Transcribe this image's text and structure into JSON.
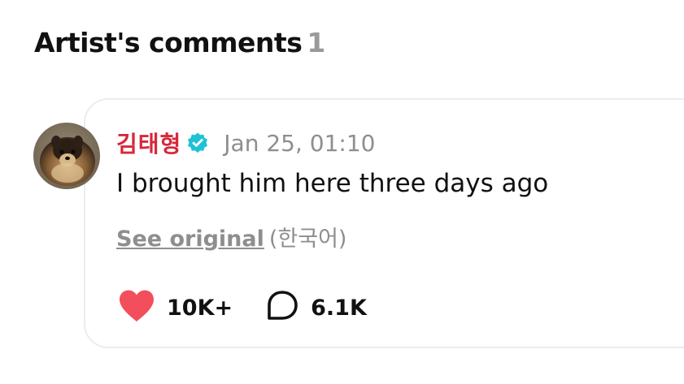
{
  "section": {
    "title": "Artist's comments",
    "count": "1"
  },
  "comment": {
    "author": "김태형",
    "timestamp": "Jan 25, 01:10",
    "text": "I brought him here three days ago",
    "see_original_label": "See original",
    "original_language": "(한국어)",
    "likes": "10K+",
    "replies": "6.1K"
  },
  "icons": {
    "verified": "verified-badge-icon",
    "like": "heart-icon",
    "reply": "speech-bubble-icon"
  },
  "colors": {
    "author": "#d7283a",
    "verified": "#1fc1d6",
    "heart": "#f24e5b",
    "muted": "#8e8e8e"
  }
}
